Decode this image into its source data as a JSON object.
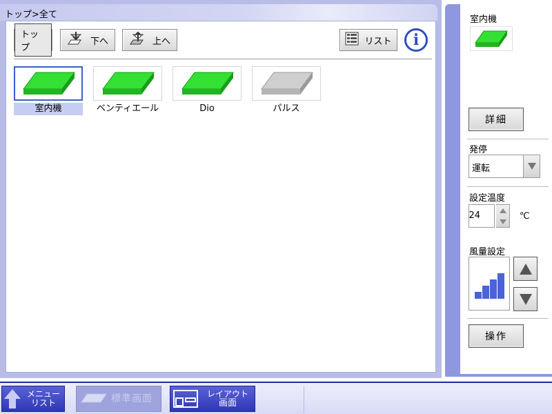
{
  "breadcrumb": "トップ>全て",
  "toolbar": {
    "top_label": "トップ",
    "down_label": "下へ",
    "up_label": "上へ",
    "list_label": "リスト",
    "info_label": "i"
  },
  "devices": [
    {
      "name": "室内機",
      "color": "#33e033",
      "selected": true
    },
    {
      "name": "ベンティエール",
      "color": "#33e033",
      "selected": false
    },
    {
      "name": "Dio",
      "color": "#33e033",
      "selected": false
    },
    {
      "name": "パルス",
      "color": "#cfcfcf",
      "selected": false
    }
  ],
  "right_panel": {
    "title": "室内機",
    "detail_button": "詳細",
    "start_stop_label": "発停",
    "start_stop_value": "運転",
    "temp_label": "設定温度",
    "temp_value": "24",
    "temp_unit": "℃",
    "fan_label": "風量設定",
    "fan_level": 4,
    "operate_button": "操作"
  },
  "bottom_bar": {
    "menu_line1": "メニュー",
    "menu_line2": "リスト",
    "standard_label": "標準画面",
    "layout_line1": "レイアウト",
    "layout_line2": "画面"
  },
  "colors": {
    "accent": "#2f38b4",
    "panel": "#8f97de",
    "frame": "#b8bde8",
    "device_on": "#33e033",
    "device_off": "#cfcfcf"
  }
}
